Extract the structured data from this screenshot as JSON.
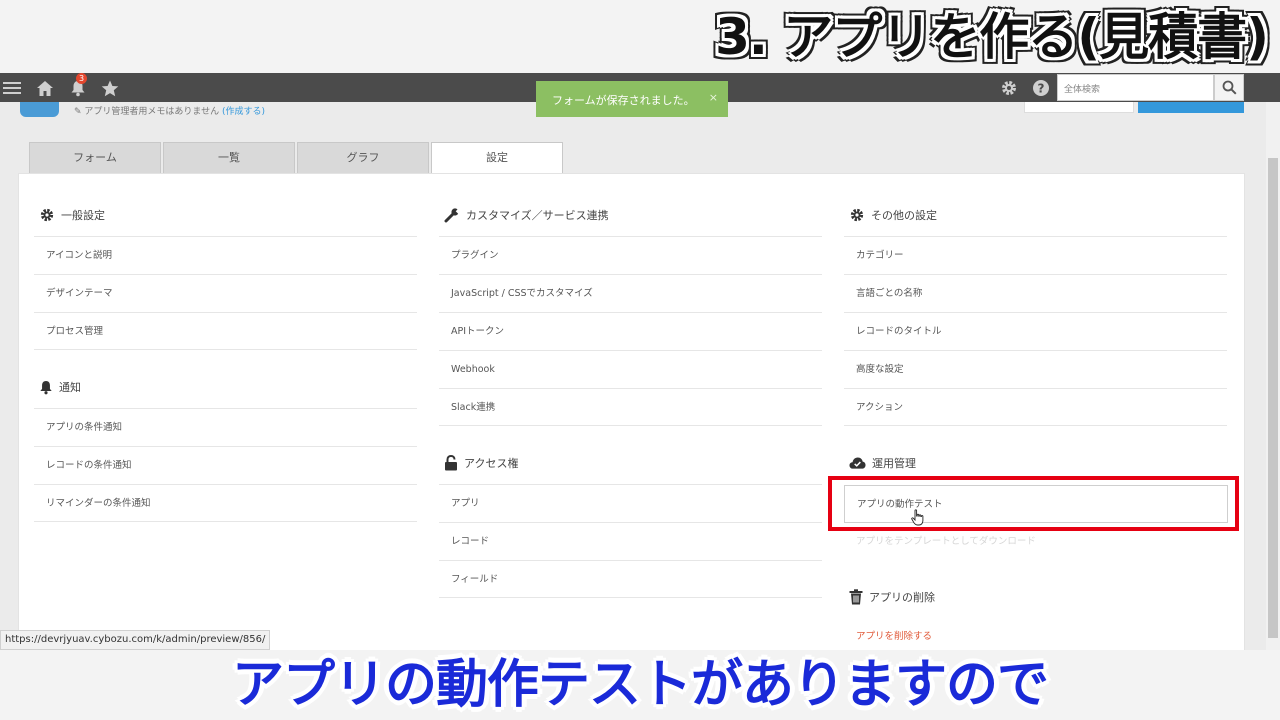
{
  "captions": {
    "top": "3. アプリを作る(見積書)",
    "bottom": "アプリの動作テストがありますので"
  },
  "header": {
    "notification_count": "3",
    "search_placeholder": "全体検索"
  },
  "toast": {
    "message": "フォームが保存されました。",
    "close": "×"
  },
  "subheader": {
    "memo": "アプリ管理者用メモはありません",
    "memo_link": "(作成する)"
  },
  "tabs": [
    "フォーム",
    "一覧",
    "グラフ",
    "設定"
  ],
  "active_tab": "設定",
  "sections": {
    "general": {
      "title": "一般設定",
      "items": [
        "アイコンと説明",
        "デザインテーマ",
        "プロセス管理"
      ]
    },
    "notifications": {
      "title": "通知",
      "items": [
        "アプリの条件通知",
        "レコードの条件通知",
        "リマインダーの条件通知"
      ]
    },
    "customize": {
      "title": "カスタマイズ／サービス連携",
      "items": [
        "プラグイン",
        "JavaScript / CSSでカスタマイズ",
        "APIトークン",
        "Webhook",
        "Slack連携"
      ]
    },
    "access": {
      "title": "アクセス権",
      "items": [
        "アプリ",
        "レコード",
        "フィールド"
      ]
    },
    "other": {
      "title": "その他の設定",
      "items": [
        "カテゴリー",
        "言語ごとの名称",
        "レコードのタイトル",
        "高度な設定",
        "アクション"
      ]
    },
    "operation": {
      "title": "運用管理",
      "items": [
        "アプリの動作テスト",
        "アプリをテンプレートとしてダウンロード"
      ]
    },
    "delete": {
      "title": "アプリの削除",
      "items": [
        "アプリを削除する"
      ]
    }
  },
  "status_url": "https://devrjyuav.cybozu.com/k/admin/preview/856/",
  "colors": {
    "header_bg": "#4b4b4b",
    "toast_bg": "#8cbf62",
    "accent_blue": "#3498db",
    "highlight_red": "#e60012",
    "danger_text": "#e05a3a",
    "caption_blue": "#1a2ad8"
  },
  "icons": {
    "general": "gear-icon",
    "notifications": "bell-icon",
    "customize": "wrench-icon",
    "access": "lock-icon",
    "other": "gear-icon",
    "operation": "cloud-check-icon",
    "delete": "trash-icon"
  }
}
